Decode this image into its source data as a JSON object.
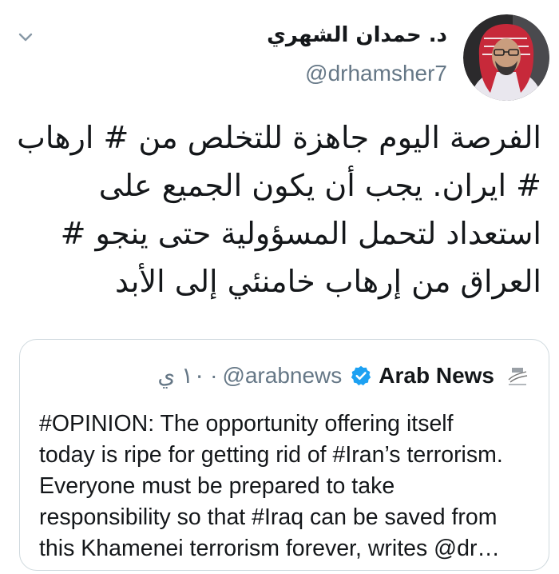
{
  "tweet": {
    "author_name": "د. حمدان الشهري",
    "author_handle": "@drhamsher7",
    "text_lines": [
      "الفرصة اليوم جاهزة للتخلص من # ارهاب",
      "# ايران.  يجب أن يكون الجميع على",
      "استعداد لتحمل المسؤولية حتى ينجو #",
      "العراق من إرهاب خامنئي إلى الأبد"
    ],
    "more_icon": "chevron-down-icon",
    "avatar_icon": "profile-photo"
  },
  "quoted_tweet": {
    "author_name": "Arab News",
    "author_handle": "@arabnews",
    "time": "١٠ ي",
    "verified_icon": "verified-badge-icon",
    "logo_icon": "arab-news-logo",
    "accent_color": "#1da1f2",
    "text_lines": [
      "#OPINION: The opportunity offering itself",
      "today is ripe for getting rid of #Iran’s terrorism.",
      "Everyone must be prepared to take",
      "responsibility so that #Iraq can be saved from",
      "this Khamenei terrorism forever, writes @dr…"
    ]
  }
}
